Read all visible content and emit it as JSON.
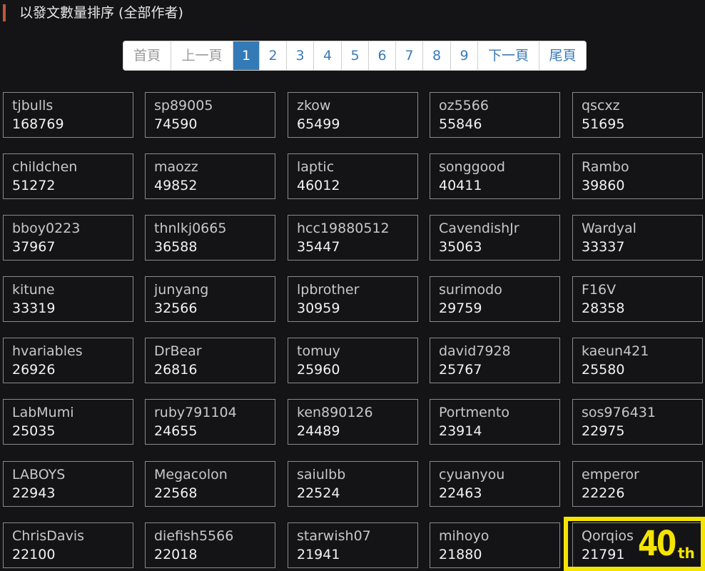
{
  "header": {
    "title": "以發文數量排序 (全部作者)"
  },
  "pagination": {
    "first": "首頁",
    "prev": "上一頁",
    "pages": [
      "1",
      "2",
      "3",
      "4",
      "5",
      "6",
      "7",
      "8",
      "9"
    ],
    "active_page": "1",
    "next": "下一頁",
    "last": "尾頁"
  },
  "authors": [
    {
      "name": "tjbulls",
      "count": "168769"
    },
    {
      "name": "sp89005",
      "count": "74590"
    },
    {
      "name": "zkow",
      "count": "65499"
    },
    {
      "name": "oz5566",
      "count": "55846"
    },
    {
      "name": "qscxz",
      "count": "51695"
    },
    {
      "name": "childchen",
      "count": "51272"
    },
    {
      "name": "maozz",
      "count": "49852"
    },
    {
      "name": "laptic",
      "count": "46012"
    },
    {
      "name": "songgood",
      "count": "40411"
    },
    {
      "name": "Rambo",
      "count": "39860"
    },
    {
      "name": "bboy0223",
      "count": "37967"
    },
    {
      "name": "thnlkj0665",
      "count": "36588"
    },
    {
      "name": "hcc19880512",
      "count": "35447"
    },
    {
      "name": "CavendishJr",
      "count": "35063"
    },
    {
      "name": "Wardyal",
      "count": "33337"
    },
    {
      "name": "kitune",
      "count": "33319"
    },
    {
      "name": "junyang",
      "count": "32566"
    },
    {
      "name": "lpbrother",
      "count": "30959"
    },
    {
      "name": "surimodo",
      "count": "29759"
    },
    {
      "name": "F16V",
      "count": "28358"
    },
    {
      "name": "hvariables",
      "count": "26926"
    },
    {
      "name": "DrBear",
      "count": "26816"
    },
    {
      "name": "tomuy",
      "count": "25960"
    },
    {
      "name": "david7928",
      "count": "25767"
    },
    {
      "name": "kaeun421",
      "count": "25580"
    },
    {
      "name": "LabMumi",
      "count": "25035"
    },
    {
      "name": "ruby791104",
      "count": "24655"
    },
    {
      "name": "ken890126",
      "count": "24489"
    },
    {
      "name": "Portmento",
      "count": "23914"
    },
    {
      "name": "sos976431",
      "count": "22975"
    },
    {
      "name": "LABOYS",
      "count": "22943"
    },
    {
      "name": "Megacolon",
      "count": "22568"
    },
    {
      "name": "saiulbb",
      "count": "22524"
    },
    {
      "name": "cyuanyou",
      "count": "22463"
    },
    {
      "name": "emperor",
      "count": "22226"
    },
    {
      "name": "ChrisDavis",
      "count": "22100"
    },
    {
      "name": "diefish5566",
      "count": "22018"
    },
    {
      "name": "starwish07",
      "count": "21941"
    },
    {
      "name": "mihoyo",
      "count": "21880"
    },
    {
      "name": "Qorqios",
      "count": "21791"
    }
  ],
  "rank_badge": {
    "number": "40",
    "suffix": "th",
    "color": "#f5e400"
  },
  "colors": {
    "background": "#141416",
    "accent": "#c0583a",
    "active_page": "#337ab7",
    "link": "#3a7ab8"
  }
}
